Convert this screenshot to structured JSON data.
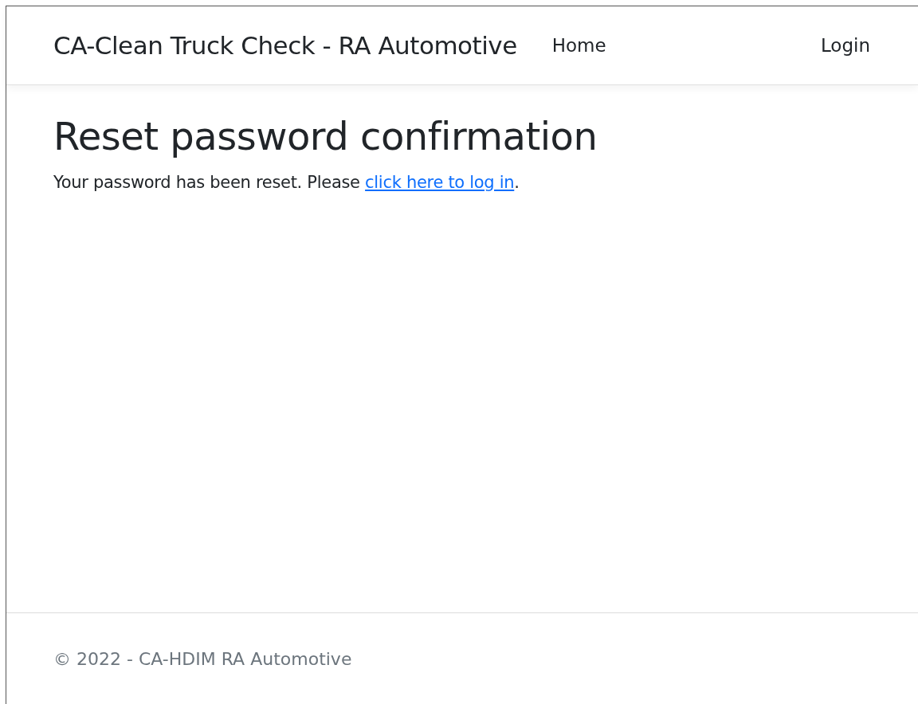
{
  "navbar": {
    "brand": "CA-Clean Truck Check - RA Automotive",
    "links": [
      {
        "label": "Home"
      }
    ],
    "right_links": [
      {
        "label": "Login"
      }
    ]
  },
  "main": {
    "heading": "Reset password confirmation",
    "message": {
      "text": "Your password has been reset. Please ",
      "link": "click here to log in",
      "after": "."
    }
  },
  "footer": {
    "text": "© 2022 - CA-HDIM RA Automotive"
  }
}
